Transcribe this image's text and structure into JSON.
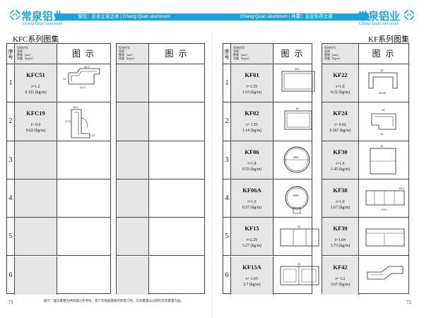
{
  "header": {
    "brand_cn": "常泉铝业",
    "brand_en": "Chang Quan aluminum",
    "slogan_left": "诚信：企业立足之本 | Chang Quan aluminum",
    "slogan_right": "Chang Quan aluminum | 共赢：企业生存之道",
    "accent_color": "#1ba3df"
  },
  "left_page": {
    "title": "KFC系列图集",
    "page_number": "71",
    "footnote": "提示：理论重量为供给理论参考值，客户可根据需要的厚度订购，实际重量以过磅的实际重量为准。"
  },
  "right_page": {
    "title": "KF系列图集",
    "page_number": "72"
  },
  "table_header": {
    "seq_label": "序\n号",
    "info_lines": [
      "型材代号",
      "名称",
      "壁厚（mm）",
      "米重（Kg/m）"
    ],
    "picture_label": "图 示"
  },
  "tables": {
    "kfc": [
      {
        "seq": "1",
        "code": "KFC51",
        "thickness": "t=1.2",
        "weight": "0.321 (kg/m)",
        "dims": [
          "45.7",
          "24.3",
          "12"
        ]
      },
      {
        "seq": "2",
        "code": "KFC19",
        "thickness": "t= 0.9",
        "weight": "0.62 (kg/m)",
        "dims": [
          "19.1",
          "17.5",
          "3.6"
        ]
      },
      {
        "seq": "3"
      },
      {
        "seq": "4"
      },
      {
        "seq": "5"
      },
      {
        "seq": "6"
      }
    ],
    "kf_a": [
      {
        "seq": "1",
        "code": "KF01",
        "thickness": "t=1.55",
        "weight": "1.53 (kg/m)",
        "dims": [
          "100",
          "31"
        ]
      },
      {
        "seq": "2",
        "code": "KF02",
        "thickness": "t= 1.55",
        "weight": "1.14 (kg/m)",
        "dims": [
          "80",
          "31"
        ]
      },
      {
        "seq": "3",
        "code": "KF06",
        "thickness": "t=1.8",
        "weight": "0.55 (kg/m)",
        "dims": [
          "Ø80"
        ]
      },
      {
        "seq": "4",
        "code": "KF06A",
        "thickness": "t=1.6",
        "weight": "0.57 (kg/m)",
        "dims": [
          "Ø50"
        ]
      },
      {
        "seq": "5",
        "code": "KF15",
        "thickness": "t=2.25",
        "weight": "3.27 (kg/m)",
        "dims": [
          "31"
        ]
      },
      {
        "seq": "6",
        "code": "KF15A",
        "thickness": "t= 1.65",
        "weight": "2.7 (kg/m)",
        "dims": [
          "31"
        ]
      }
    ],
    "kf_b": [
      {
        "seq": "",
        "code": "KF22",
        "thickness": "t=1.0",
        "weight": "0.22 (kg/m)",
        "dims": [
          "30",
          "28.26"
        ]
      },
      {
        "seq": "",
        "code": "KF24",
        "thickness": "t= 0.92",
        "weight": "0.267 (kg/m)",
        "dims": [
          "42",
          "32"
        ]
      },
      {
        "seq": "",
        "code": "KF30",
        "thickness": "t=1.6",
        "weight": "1.45 (kg/m)",
        "dims": [
          "40"
        ]
      },
      {
        "seq": "",
        "code": "KF38",
        "thickness": "t=1.0",
        "weight": "1.67 (kg/m)",
        "dims": [
          "200",
          "24.3"
        ]
      },
      {
        "seq": "",
        "code": "KF39",
        "thickness": "t=1.64",
        "weight": "1.73 (kg/m)",
        "dims": []
      },
      {
        "seq": "",
        "code": "KF42",
        "thickness": "t= 3.2",
        "weight": "3.67 (kg/m)",
        "dims": []
      }
    ]
  }
}
